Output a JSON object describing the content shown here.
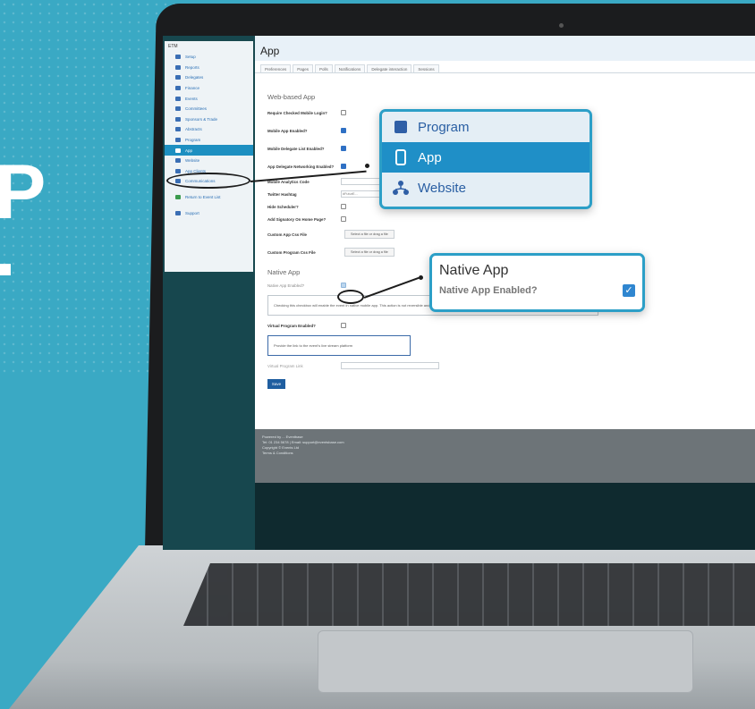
{
  "hero": {
    "letter_p": "P",
    "letter_dot": "."
  },
  "sidebar": {
    "brand": "ETM",
    "items": [
      {
        "label": "Setup",
        "icon": "wrench-icon"
      },
      {
        "label": "Reports",
        "icon": "chart-icon"
      },
      {
        "label": "Delegates",
        "icon": "people-icon"
      },
      {
        "label": "Finance",
        "icon": "dollar-icon"
      },
      {
        "label": "Events",
        "icon": "globe-icon"
      },
      {
        "label": "Committees",
        "icon": "group-icon"
      },
      {
        "label": "Sponsors & Trade",
        "icon": "handshake-icon"
      },
      {
        "label": "Abstracts",
        "icon": "document-icon"
      },
      {
        "label": "Program",
        "icon": "book-icon"
      },
      {
        "label": "App",
        "icon": "phone-icon"
      },
      {
        "label": "Website",
        "icon": "sitemap-icon"
      },
      {
        "label": "App Clients",
        "icon": "key-icon"
      },
      {
        "label": "Communications",
        "icon": "mail-icon"
      }
    ],
    "return_label": "Return to Event List",
    "support_label": "Support"
  },
  "main": {
    "title": "App",
    "tabs": [
      "Preferences",
      "Pages",
      "Polls",
      "Notifications",
      "Delegate interaction",
      "Sessions"
    ],
    "web_section_title": "Web-based App",
    "rows": [
      {
        "label": "Require Checked Mobile Login?",
        "checked": false
      },
      {
        "label": "Mobile App Enabled?",
        "checked": true
      },
      {
        "label": "Mobile Delegate List Enabled?",
        "checked": true
      },
      {
        "label": "App Delegate Networking Enabled?",
        "checked": true
      }
    ],
    "analytics_label": "Mobile Analytics Code",
    "twitter_label": "Twitter Hashtag",
    "twitter_value": "#FuturE...",
    "hide_scheduler_label": "Hide Scheduler?",
    "add_signatory_label": "Add Signatory On Home Page?",
    "custom_app_css_label": "Custom App Css File",
    "custom_program_css_label": "Custom Program Css File",
    "file_button": "Select a file or drag a file",
    "native_section_title": "Native App",
    "native_enabled_label": "Native App Enabled?",
    "native_note": "Checking this checkbox will enable the event in native mobile app. This action is not reversible and will generate an invoice.",
    "native_note_suffix": "...virtual programs",
    "virtual_label": "Virtual Program Enabled?",
    "virtual_note": "Provide the link to the event's live stream platform",
    "virtual_link_label": "Virtual Program Link",
    "save_label": "Save"
  },
  "footer": {
    "line1": "Powered by ... Eventbase",
    "line2": "Tel: 01 234 5678 | Email: support@eventsbase.com",
    "line3": "Copyright © Events Ltd",
    "line4": "Terms & Conditions"
  },
  "callout_nav": {
    "items": [
      {
        "label": "Program",
        "icon": "book-icon",
        "active": false
      },
      {
        "label": "App",
        "icon": "phone-icon",
        "active": true
      },
      {
        "label": "Website",
        "icon": "sitemap-icon",
        "active": false
      }
    ]
  },
  "callout_native": {
    "title": "Native App",
    "label": "Native App Enabled?",
    "checked": true,
    "check_glyph": "✓"
  },
  "colors": {
    "background": "#3aa9c4",
    "accent": "#1f8fc7",
    "callout_border": "#2c9fc7"
  }
}
